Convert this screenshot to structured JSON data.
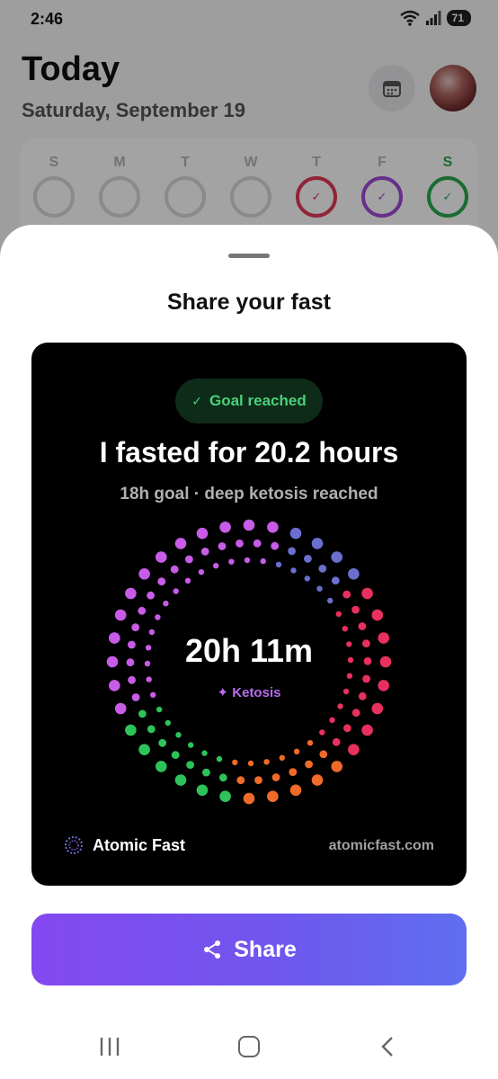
{
  "status_bar": {
    "time": "2:46",
    "battery": "71"
  },
  "background": {
    "title": "Today",
    "date": "Saturday, September 19",
    "week": [
      {
        "letter": "S",
        "state": "empty",
        "color": "#d8d8d8"
      },
      {
        "letter": "M",
        "state": "empty",
        "color": "#d8d8d8"
      },
      {
        "letter": "T",
        "state": "empty",
        "color": "#d8d8d8"
      },
      {
        "letter": "W",
        "state": "empty",
        "color": "#d8d8d8"
      },
      {
        "letter": "T",
        "state": "done",
        "color": "#e03a57"
      },
      {
        "letter": "F",
        "state": "done",
        "color": "#a04ad8"
      },
      {
        "letter": "S",
        "state": "current",
        "color": "#2aa84f"
      }
    ]
  },
  "sheet": {
    "title": "Share your fast",
    "card": {
      "goal_badge": "Goal reached",
      "headline": "I fasted for 20.2 hours",
      "subline": "18h goal · deep ketosis reached",
      "elapsed": "20h 11m",
      "phase": "✦ Ketosis",
      "brand_name": "Atomic Fast",
      "brand_url": "atomicfast.com",
      "ring_colors": [
        "#c85ce8",
        "#6a6fcf",
        "#e8305f",
        "#f06a2a",
        "#2ec35a"
      ]
    },
    "share_button": "Share"
  },
  "colors": {
    "accent_start": "#8448f0",
    "accent_end": "#5f6ef0",
    "goal_green": "#4ad07a"
  }
}
